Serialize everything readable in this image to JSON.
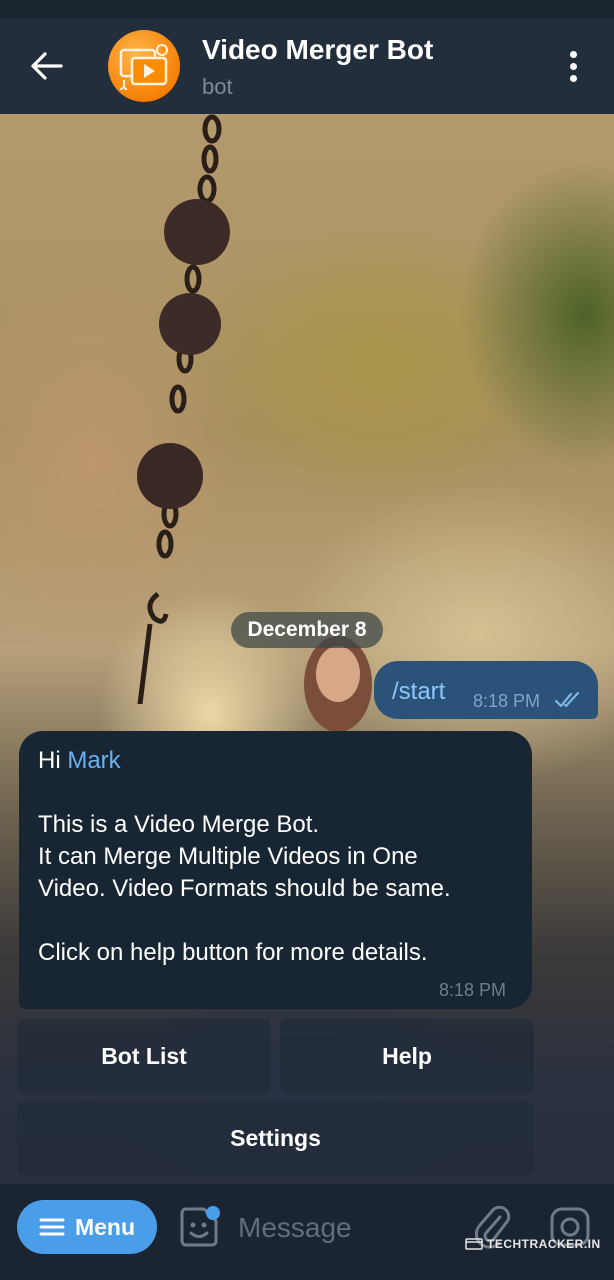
{
  "header": {
    "title": "Video Merger Bot",
    "subtitle": "bot"
  },
  "chat": {
    "date_divider": "December 8",
    "outgoing": {
      "text": "/start",
      "time": "8:18 PM",
      "status": "read"
    },
    "incoming": {
      "greeting": "Hi",
      "mention": "Mark",
      "lines": [
        "This is a Video Merge Bot.",
        "It can Merge Multiple Videos in One",
        "Video. Video Formats should be same."
      ],
      "footer_line": "Click on help button for more details.",
      "time": "8:18 PM"
    },
    "keyboard": {
      "bot_list": "Bot List",
      "help": "Help",
      "settings": "Settings"
    }
  },
  "input_bar": {
    "menu_label": "Menu",
    "placeholder": "Message"
  },
  "watermark": {
    "text": "TECHTRACKER.IN"
  },
  "icons": {
    "back": "arrow-left-icon",
    "more": "more-vertical-icon",
    "menu": "hamburger-icon",
    "sticker": "sticker-icon",
    "attach": "paperclip-icon",
    "camera": "camera-icon",
    "ticks": "double-check-icon"
  },
  "colors": {
    "header_bg": "#232e3c",
    "outgoing_bubble": "#2b5278",
    "incoming_bubble": "#182533",
    "accent": "#4a9de8",
    "mention": "#6ab3f3",
    "avatar": "#f57c00"
  }
}
